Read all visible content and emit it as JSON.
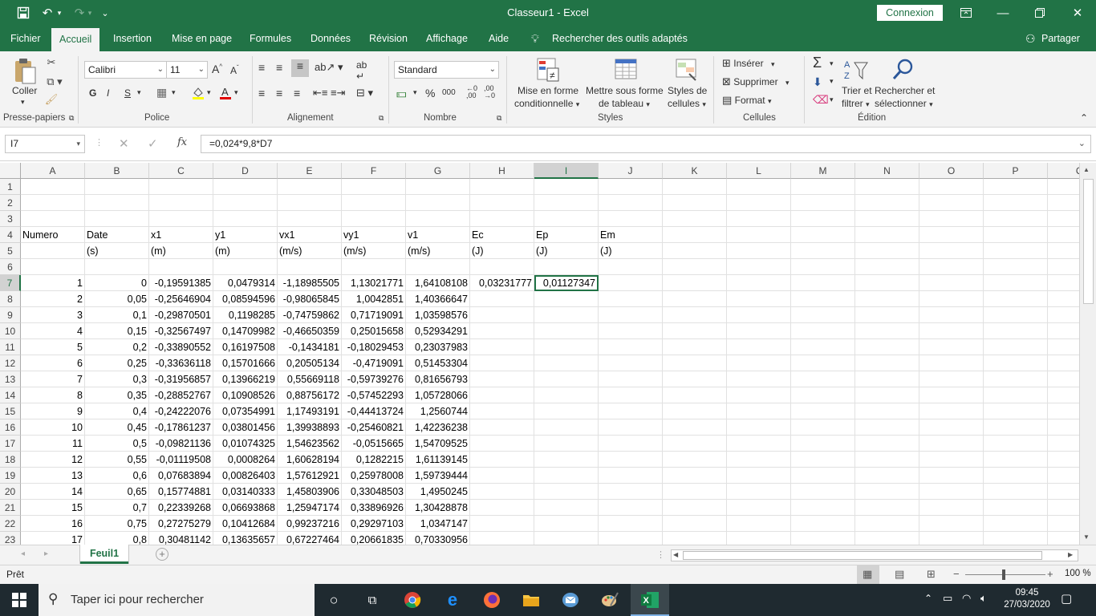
{
  "window": {
    "title": "Classeur1  -  Excel",
    "connexion_label": "Connexion"
  },
  "tabs": [
    "Fichier",
    "Accueil",
    "Insertion",
    "Mise en page",
    "Formules",
    "Données",
    "Révision",
    "Affichage",
    "Aide"
  ],
  "active_tab": "Accueil",
  "search_tools": "Rechercher des outils adaptés",
  "share_label": "Partager",
  "ribbon": {
    "clipboard": {
      "paste": "Coller",
      "label": "Presse-papiers"
    },
    "font": {
      "name": "Calibri",
      "size": "11",
      "bold": "G",
      "italic": "I",
      "underline": "S",
      "label": "Police"
    },
    "alignment": {
      "label": "Alignement"
    },
    "number": {
      "format": "Standard",
      "percent": "%",
      "thousands": "000",
      "label": "Nombre"
    },
    "styles": {
      "conditional_1": "Mise en forme",
      "conditional_2": "conditionnelle",
      "table_1": "Mettre sous forme",
      "table_2": "de tableau",
      "cell_1": "Styles de",
      "cell_2": "cellules",
      "label": "Styles"
    },
    "cells": {
      "insert": "Insérer",
      "delete": "Supprimer",
      "format": "Format",
      "label": "Cellules"
    },
    "editing": {
      "sort_1": "Trier et",
      "sort_2": "filtrer",
      "find_1": "Rechercher et",
      "find_2": "sélectionner",
      "label": "Édition"
    }
  },
  "formula_bar": {
    "name_box": "I7",
    "fx": "fx",
    "formula": "=0,024*9,8*D7"
  },
  "columns": [
    "A",
    "B",
    "C",
    "D",
    "E",
    "F",
    "G",
    "H",
    "I",
    "J",
    "K",
    "L",
    "M",
    "N",
    "O",
    "P",
    "Q"
  ],
  "rows": [
    {
      "n": "1",
      "cells": [
        "",
        "",
        "",
        "",
        "",
        "",
        "",
        "",
        "",
        ""
      ]
    },
    {
      "n": "2",
      "cells": [
        "",
        "",
        "",
        "",
        "",
        "",
        "",
        "",
        "",
        ""
      ]
    },
    {
      "n": "3",
      "cells": [
        "",
        "",
        "",
        "",
        "",
        "",
        "",
        "",
        "",
        ""
      ]
    },
    {
      "n": "4",
      "cells": [
        "Numero",
        "Date",
        "x1",
        "y1",
        "vx1",
        "vy1",
        "v1",
        "Ec",
        "Ep",
        "Em"
      ]
    },
    {
      "n": "5",
      "cells": [
        "",
        "(s)",
        "(m)",
        "(m)",
        "(m/s)",
        "(m/s)",
        "(m/s)",
        "(J)",
        "(J)",
        "(J)"
      ]
    },
    {
      "n": "6",
      "cells": [
        "",
        "",
        "",
        "",
        "",
        "",
        "",
        "",
        "",
        ""
      ]
    },
    {
      "n": "7",
      "cells": [
        "1",
        "0",
        "-0,19591385",
        "0,0479314",
        "-1,18985505",
        "1,13021771",
        "1,64108108",
        "0,03231777",
        "0,01127347",
        ""
      ]
    },
    {
      "n": "8",
      "cells": [
        "2",
        "0,05",
        "-0,25646904",
        "0,08594596",
        "-0,98065845",
        "1,0042851",
        "1,40366647",
        "",
        "",
        ""
      ]
    },
    {
      "n": "9",
      "cells": [
        "3",
        "0,1",
        "-0,29870501",
        "0,1198285",
        "-0,74759862",
        "0,71719091",
        "1,03598576",
        "",
        "",
        ""
      ]
    },
    {
      "n": "10",
      "cells": [
        "4",
        "0,15",
        "-0,32567497",
        "0,14709982",
        "-0,46650359",
        "0,25015658",
        "0,52934291",
        "",
        "",
        ""
      ]
    },
    {
      "n": "11",
      "cells": [
        "5",
        "0,2",
        "-0,33890552",
        "0,16197508",
        "-0,1434181",
        "-0,18029453",
        "0,23037983",
        "",
        "",
        ""
      ]
    },
    {
      "n": "12",
      "cells": [
        "6",
        "0,25",
        "-0,33636118",
        "0,15701666",
        "0,20505134",
        "-0,4719091",
        "0,51453304",
        "",
        "",
        ""
      ]
    },
    {
      "n": "13",
      "cells": [
        "7",
        "0,3",
        "-0,31956857",
        "0,13966219",
        "0,55669118",
        "-0,59739276",
        "0,81656793",
        "",
        "",
        ""
      ]
    },
    {
      "n": "14",
      "cells": [
        "8",
        "0,35",
        "-0,28852767",
        "0,10908526",
        "0,88756172",
        "-0,57452293",
        "1,05728066",
        "",
        "",
        ""
      ]
    },
    {
      "n": "15",
      "cells": [
        "9",
        "0,4",
        "-0,24222076",
        "0,07354991",
        "1,17493191",
        "-0,44413724",
        "1,2560744",
        "",
        "",
        ""
      ]
    },
    {
      "n": "16",
      "cells": [
        "10",
        "0,45",
        "-0,17861237",
        "0,03801456",
        "1,39938893",
        "-0,25460821",
        "1,42236238",
        "",
        "",
        ""
      ]
    },
    {
      "n": "17",
      "cells": [
        "11",
        "0,5",
        "-0,09821136",
        "0,01074325",
        "1,54623562",
        "-0,0515665",
        "1,54709525",
        "",
        "",
        ""
      ]
    },
    {
      "n": "18",
      "cells": [
        "12",
        "0,55",
        "-0,01119508",
        "0,0008264",
        "1,60628194",
        "0,1282215",
        "1,61139145",
        "",
        "",
        ""
      ]
    },
    {
      "n": "19",
      "cells": [
        "13",
        "0,6",
        "0,07683894",
        "0,00826403",
        "1,57612921",
        "0,25978008",
        "1,59739444",
        "",
        "",
        ""
      ]
    },
    {
      "n": "20",
      "cells": [
        "14",
        "0,65",
        "0,15774881",
        "0,03140333",
        "1,45803906",
        "0,33048503",
        "1,4950245",
        "",
        "",
        ""
      ]
    },
    {
      "n": "21",
      "cells": [
        "15",
        "0,7",
        "0,22339268",
        "0,06693868",
        "1,25947174",
        "0,33896926",
        "1,30428878",
        "",
        "",
        ""
      ]
    },
    {
      "n": "22",
      "cells": [
        "16",
        "0,75",
        "0,27275279",
        "0,10412684",
        "0,99237216",
        "0,29297103",
        "1,0347147",
        "",
        "",
        ""
      ]
    },
    {
      "n": "23",
      "cells": [
        "17",
        "0,8",
        "0,30481142",
        "0,13635657",
        "0,67227464",
        "0,20661835",
        "0,70330956",
        "",
        "",
        ""
      ]
    }
  ],
  "sheet": {
    "name": "Feuil1"
  },
  "status": {
    "ready": "Prêt",
    "zoom": "100 %"
  },
  "taskbar": {
    "search_placeholder": "Taper ici pour rechercher",
    "time": "09:45",
    "date": "27/03/2020"
  }
}
